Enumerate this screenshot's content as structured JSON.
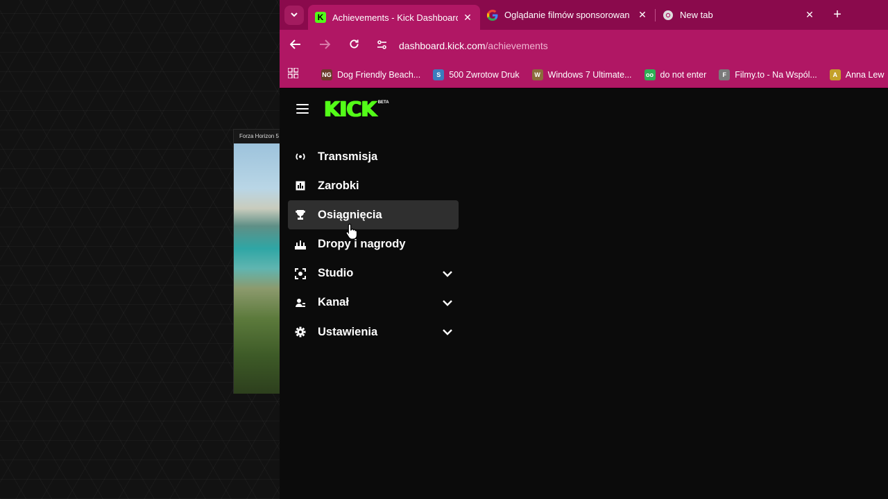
{
  "desktop": {
    "game_thumb_title": "Forza Horizon 5"
  },
  "browser": {
    "tabs": [
      {
        "label": "Achievements - Kick Dashboard",
        "icon": "kick-icon",
        "active": true
      },
      {
        "label": "Oglądanie filmów sponsorowan",
        "icon": "google-icon",
        "active": false
      },
      {
        "label": "New tab",
        "icon": "chrome-icon",
        "active": false
      }
    ],
    "url_host": "dashboard.kick.com",
    "url_path": "/achievements",
    "bookmarks": [
      {
        "label": "Dog Friendly Beach...",
        "icon_color": "#6b3b2a",
        "glyph": "NG"
      },
      {
        "label": "500 Zwrotow Druk",
        "icon_color": "#3b7dbd",
        "glyph": "S"
      },
      {
        "label": "Windows 7 Ultimate...",
        "icon_color": "#8a6d3b",
        "glyph": "W"
      },
      {
        "label": "do not enter",
        "icon_color": "#2eae55",
        "glyph": "oo"
      },
      {
        "label": "Filmy.to - Na Wspól...",
        "icon_color": "#7a7a7a",
        "glyph": "F"
      },
      {
        "label": "Anna Lew",
        "icon_color": "#c4a02a",
        "glyph": "A"
      }
    ]
  },
  "colors": {
    "brand": "#53fc18",
    "tabbar": "#8a0a4c",
    "toolbar": "#b01764"
  },
  "app": {
    "logo": "KICK",
    "logo_badge": "BETA",
    "sidebar": [
      {
        "label": "Transmisja",
        "icon": "broadcast-icon",
        "active": false,
        "expandable": false
      },
      {
        "label": "Zarobki",
        "icon": "earnings-chart-icon",
        "active": false,
        "expandable": false
      },
      {
        "label": "Osiągnięcia",
        "icon": "trophy-icon",
        "active": true,
        "expandable": false
      },
      {
        "label": "Dropy i nagrody",
        "icon": "drops-icon",
        "active": false,
        "expandable": false
      },
      {
        "label": "Studio",
        "icon": "studio-icon",
        "active": false,
        "expandable": true
      },
      {
        "label": "Kanał",
        "icon": "channel-icon",
        "active": false,
        "expandable": true
      },
      {
        "label": "Ustawienia",
        "icon": "gear-icon",
        "active": false,
        "expandable": true
      }
    ]
  }
}
